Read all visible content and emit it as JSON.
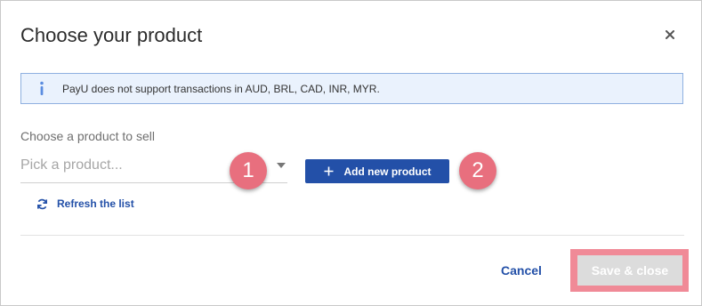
{
  "dialog": {
    "title": "Choose your product",
    "close_icon": "close-icon"
  },
  "info_banner": {
    "icon": "info-icon",
    "text": "PayU does not support transactions in AUD, BRL, CAD, INR, MYR."
  },
  "product_field": {
    "label": "Choose a product to sell",
    "placeholder": "Pick a product...",
    "arrow_icon": "caret-down-icon"
  },
  "add_button": {
    "icon": "plus-icon",
    "label": "Add new product"
  },
  "refresh": {
    "icon": "refresh-icon",
    "label": "Refresh the list"
  },
  "markers": [
    "1",
    "2"
  ],
  "footer": {
    "cancel_label": "Cancel",
    "save_label": "Save & close"
  },
  "colors": {
    "accent": "#2350a8",
    "marker": "#e86f7e",
    "banner_bg": "#eaf2fd",
    "banner_border": "#8fb0e0",
    "save_disabled": "#dcdcdc",
    "save_highlight": "#f08a97"
  }
}
